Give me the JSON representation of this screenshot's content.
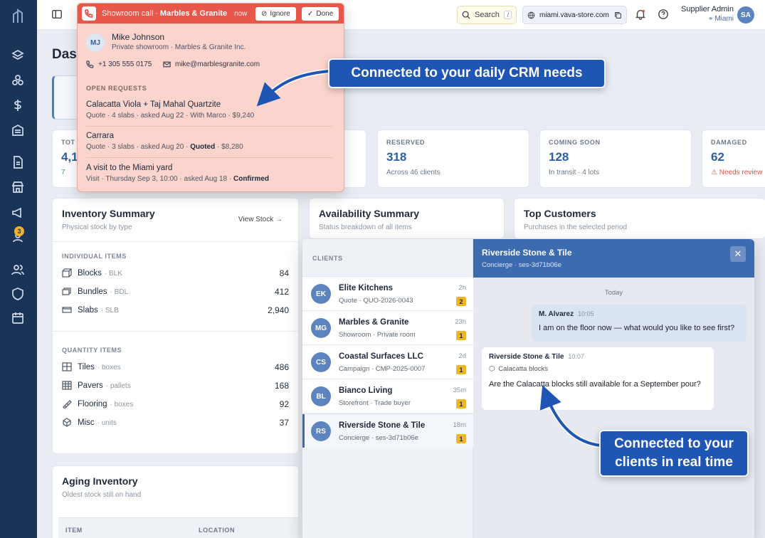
{
  "topbar": {
    "search_label": "Search",
    "search_shortcut": "/",
    "domain": "miami.vava-store.com",
    "user_name": "Supplier Admin",
    "user_location": "Miami",
    "avatar_initials": "SA"
  },
  "sidebar": {
    "badge_count": "3"
  },
  "page": {
    "title": "Dast"
  },
  "stats": [
    {
      "label": "TOT",
      "value": "4,1",
      "sub": "7"
    },
    {
      "label": "RESERVED",
      "value": "318",
      "sub": "Across 46 clients"
    },
    {
      "label": "COMING SOON",
      "value": "128",
      "sub": "In transit · 4 lots"
    },
    {
      "label": "DAMAGED",
      "value": "62",
      "sub": "Needs review"
    }
  ],
  "inventory": {
    "title": "Inventory Summary",
    "subtitle": "Physical stock by type",
    "view_link": "View Stock",
    "individual_label": "INDIVIDUAL ITEMS",
    "individual": [
      {
        "name": "Blocks",
        "unit": "BLK",
        "value": "84"
      },
      {
        "name": "Bundles",
        "unit": "BDL",
        "value": "412"
      },
      {
        "name": "Slabs",
        "unit": "SLB",
        "value": "2,940"
      }
    ],
    "quantity_label": "QUANTITY ITEMS",
    "quantity": [
      {
        "name": "Tiles",
        "unit": "boxes",
        "value": "486"
      },
      {
        "name": "Pavers",
        "unit": "pallets",
        "value": "168"
      },
      {
        "name": "Flooring",
        "unit": "boxes",
        "value": "92"
      },
      {
        "name": "Misc",
        "unit": "units",
        "value": "37"
      }
    ]
  },
  "availability": {
    "title": "Availability Summary",
    "subtitle": "Status breakdown of all items"
  },
  "top_customers": {
    "title": "Top Customers",
    "subtitle": "Purchases in the selected period"
  },
  "aging": {
    "title": "Aging Inventory",
    "subtitle": "Oldest stock still on hand",
    "col_item": "ITEM",
    "col_location": "LOCATION"
  },
  "call": {
    "label": "Showroom call",
    "company": "Marbles & Granite",
    "time": "now",
    "ignore": "Ignore",
    "done": "Done",
    "initials": "MJ",
    "name": "Mike Johnson",
    "desc": "Private showroom · Marbles & Granite Inc.",
    "phone": "+1 305 555 0175",
    "email": "mike@marblesgranite.com",
    "open_requests_label": "OPEN REQUESTS",
    "requests": [
      {
        "title": "Calacatta Viola + Taj Mahal Quartzite",
        "meta": "Quote · 4 slabs · asked Aug 22 · With Marco · $9,240",
        "strong": ""
      },
      {
        "title": "Carrara",
        "meta_pre": "Quote · 3 slabs · asked Aug 20 · ",
        "strong": "Quoted",
        "meta_post": " · $8,280"
      },
      {
        "title": "A visit to the Miami yard",
        "meta_pre": "Visit · Thursday Sep 3, 10:00 · asked Aug 18 · ",
        "strong": "Confirmed",
        "meta_post": ""
      }
    ]
  },
  "clients": {
    "label": "CLIENTS",
    "items": [
      {
        "initials": "EK",
        "name": "Elite Kitchens",
        "meta": "Quote · QUO-2026-0043",
        "time": "2h",
        "badge": "2"
      },
      {
        "initials": "MG",
        "name": "Marbles & Granite",
        "meta": "Showroom · Private room",
        "time": "23h",
        "badge": "1"
      },
      {
        "initials": "CS",
        "name": "Coastal Surfaces LLC",
        "meta": "Campaign · CMP-2025-0007",
        "time": "2d",
        "badge": "1"
      },
      {
        "initials": "BL",
        "name": "Bianco Living",
        "meta": "Storefront · Trade buyer",
        "time": "35m",
        "badge": "1"
      },
      {
        "initials": "RS",
        "name": "Riverside Stone & Tile",
        "meta": "Concierge · ses-3d71b06e",
        "time": "18m",
        "badge": "1"
      }
    ]
  },
  "conversation": {
    "name": "Riverside Stone & Tile",
    "meta": "Concierge · ses-3d71b06e",
    "day": "Today",
    "out_from": "M. Alvarez",
    "out_time": "10:05",
    "out_text": "I am on the floor now — what would you like to see first?",
    "in_from": "Riverside Stone & Tile",
    "in_time": "10:07",
    "in_context": "Calacatta blocks",
    "in_text": "Are the Calacatta blocks still available for a September pour?"
  },
  "callouts": {
    "crm": "Connected to your daily CRM needs",
    "clients": "Connected to your clients in real time"
  }
}
